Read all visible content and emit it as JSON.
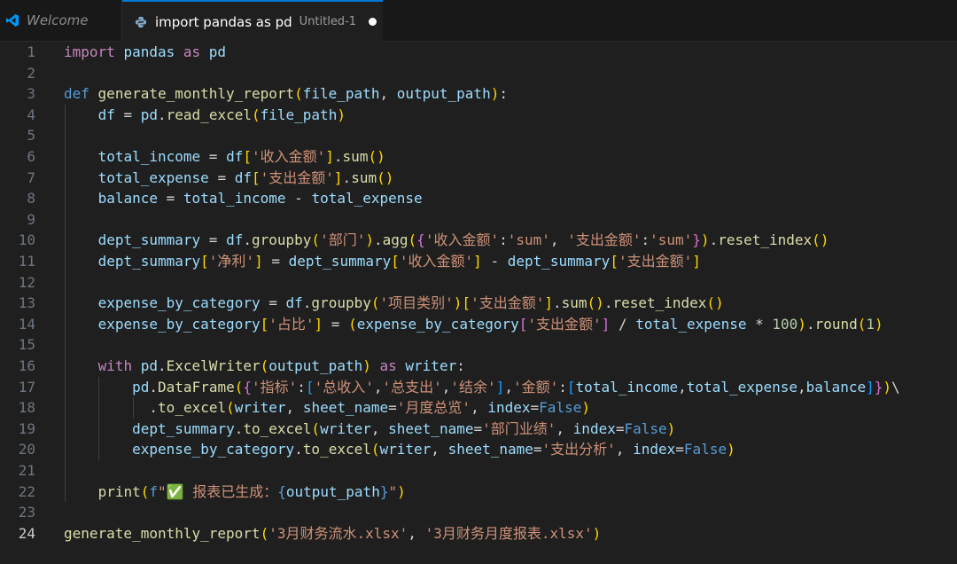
{
  "tabs": [
    {
      "label": "Welcome"
    },
    {
      "label": "import pandas as pd",
      "description": "Untitled-1",
      "dirty": true
    }
  ],
  "editor": {
    "line_numbers": [
      "1",
      "2",
      "3",
      "4",
      "5",
      "6",
      "7",
      "8",
      "9",
      "10",
      "11",
      "12",
      "13",
      "14",
      "15",
      "16",
      "17",
      "18",
      "19",
      "20",
      "21",
      "22",
      "23",
      "24"
    ],
    "active_line": "24",
    "lines": [
      "import pandas as pd",
      "",
      "def generate_monthly_report(file_path, output_path):",
      "    df = pd.read_excel(file_path)",
      "",
      "    total_income = df['收入金额'].sum()",
      "    total_expense = df['支出金额'].sum()",
      "    balance = total_income - total_expense",
      "",
      "    dept_summary = df.groupby('部门').agg({'收入金额':'sum', '支出金额':'sum'}).reset_index()",
      "    dept_summary['净利'] = dept_summary['收入金额'] - dept_summary['支出金额']",
      "",
      "    expense_by_category = df.groupby('项目类别')['支出金额'].sum().reset_index()",
      "    expense_by_category['占比'] = (expense_by_category['支出金额'] / total_expense * 100).round(1)",
      "",
      "    with pd.ExcelWriter(output_path) as writer:",
      "        pd.DataFrame({'指标':['总收入','总支出','结余'],'金额':[total_income,total_expense,balance]})\\",
      "          .to_excel(writer, sheet_name='月度总览', index=False)",
      "        dept_summary.to_excel(writer, sheet_name='部门业绩', index=False)",
      "        expense_by_category.to_excel(writer, sheet_name='支出分析', index=False)",
      "",
      "    print(f\"✅ 报表已生成：{output_path}\")",
      "",
      "generate_monthly_report('3月财务流水.xlsx', '3月财务月度报表.xlsx')"
    ]
  }
}
